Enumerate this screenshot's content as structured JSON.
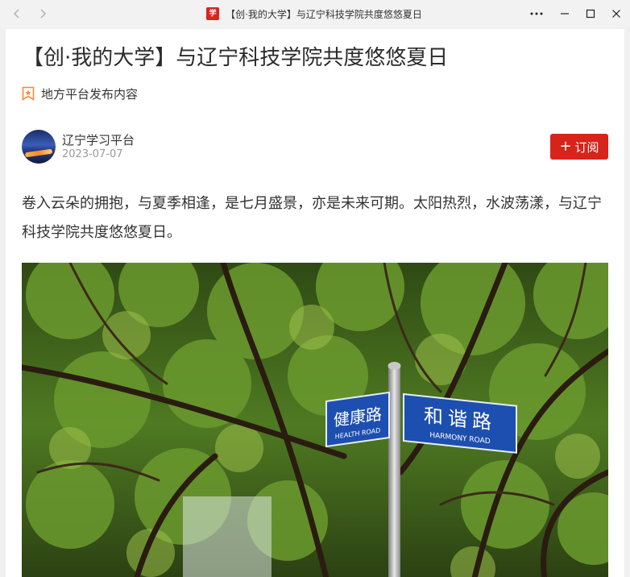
{
  "window": {
    "title": "【创·我的大学】与辽宁科技学院共度悠悠夏日",
    "logo_text": "学",
    "colors": {
      "accent": "#d7231a",
      "titlebar": "#f2f2f2"
    }
  },
  "article": {
    "title": "【创·我的大学】与辽宁科技学院共度悠悠夏日",
    "source_label": "地方平台发布内容",
    "author": "辽宁学习平台",
    "date": "2023-07-07",
    "subscribe_label": "订阅",
    "body": "卷入云朵的拥抱，与夏季相逢，是七月盛景，亦是未来可期。太阳热烈，水波荡漾，与辽宁科技学院共度悠悠夏日。",
    "image": {
      "sign_left_cn": "健康路",
      "sign_left_en": "HEALTH ROAD",
      "sign_right_cn": "和谐路",
      "sign_right_en": "HARMONY ROAD"
    }
  },
  "icons": {
    "back": "chevron-left-icon",
    "forward": "chevron-right-icon",
    "more": "more-icon",
    "minimize": "minimize-icon",
    "maximize": "maximize-icon",
    "close": "close-icon",
    "source": "badge-icon",
    "subscribe": "plus-icon"
  }
}
